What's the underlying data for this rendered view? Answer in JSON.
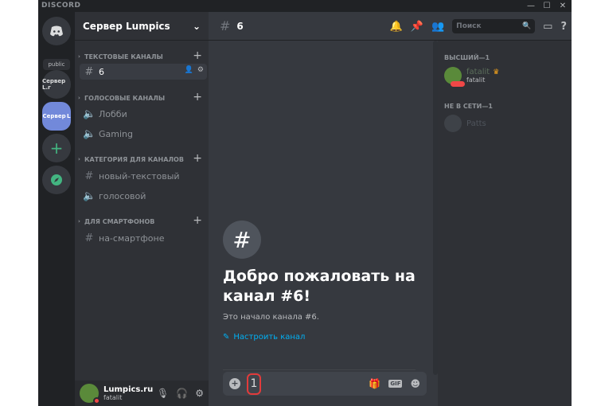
{
  "window": {
    "brand": "DISCORD",
    "controls": [
      "—",
      "☐",
      "✕"
    ]
  },
  "servers": {
    "public_label": "public",
    "items": [
      {
        "label": "Сервер L.r",
        "short": "Сервер L.r"
      },
      {
        "label": "Сервер L",
        "short": "Сервер L"
      }
    ]
  },
  "guild": {
    "name": "Сервер Lumpics",
    "chevron": "⌄"
  },
  "categories": [
    {
      "label": "ТЕКСТОВЫЕ КАНАЛЫ"
    },
    {
      "label": "ГОЛОСОВЫЕ КАНАЛЫ"
    },
    {
      "label": "КАТЕГОРИЯ ДЛЯ КАНАЛОВ"
    },
    {
      "label": "ДЛЯ СМАРТФОНОВ"
    }
  ],
  "channels": [
    {
      "label": "6",
      "type": "text",
      "selected": true
    },
    {
      "label": "Лобби",
      "type": "voice"
    },
    {
      "label": "Gaming",
      "type": "voice"
    },
    {
      "label": "новый-текстовый",
      "type": "text"
    },
    {
      "label": "голосовой",
      "type": "voice"
    },
    {
      "label": "на-смартфоне",
      "type": "text"
    }
  ],
  "user": {
    "name": "Lumpics.ru",
    "tag": "fatalit"
  },
  "channel_header": {
    "name": "6",
    "search_placeholder": "Поиск"
  },
  "welcome": {
    "title": "Добро пожаловать на канал #6!",
    "subtitle": "Это начало канала #6.",
    "setup_link": "Настроить канал"
  },
  "composer": {
    "text": "1",
    "gif_label": "GIF"
  },
  "members": {
    "roles": [
      {
        "label": "ВЫСШИЙ—1"
      },
      {
        "label": "НЕ В СЕТИ—1"
      }
    ],
    "items": [
      {
        "name": "fatalit",
        "status_text": "fatalit",
        "crown": "♛"
      },
      {
        "name": "Patts"
      }
    ]
  },
  "colors": {
    "accent": "#7289da",
    "online": "#43b581",
    "dnd": "#f04747",
    "link": "#00b0f4",
    "highlight_box": "#e23b3b"
  }
}
